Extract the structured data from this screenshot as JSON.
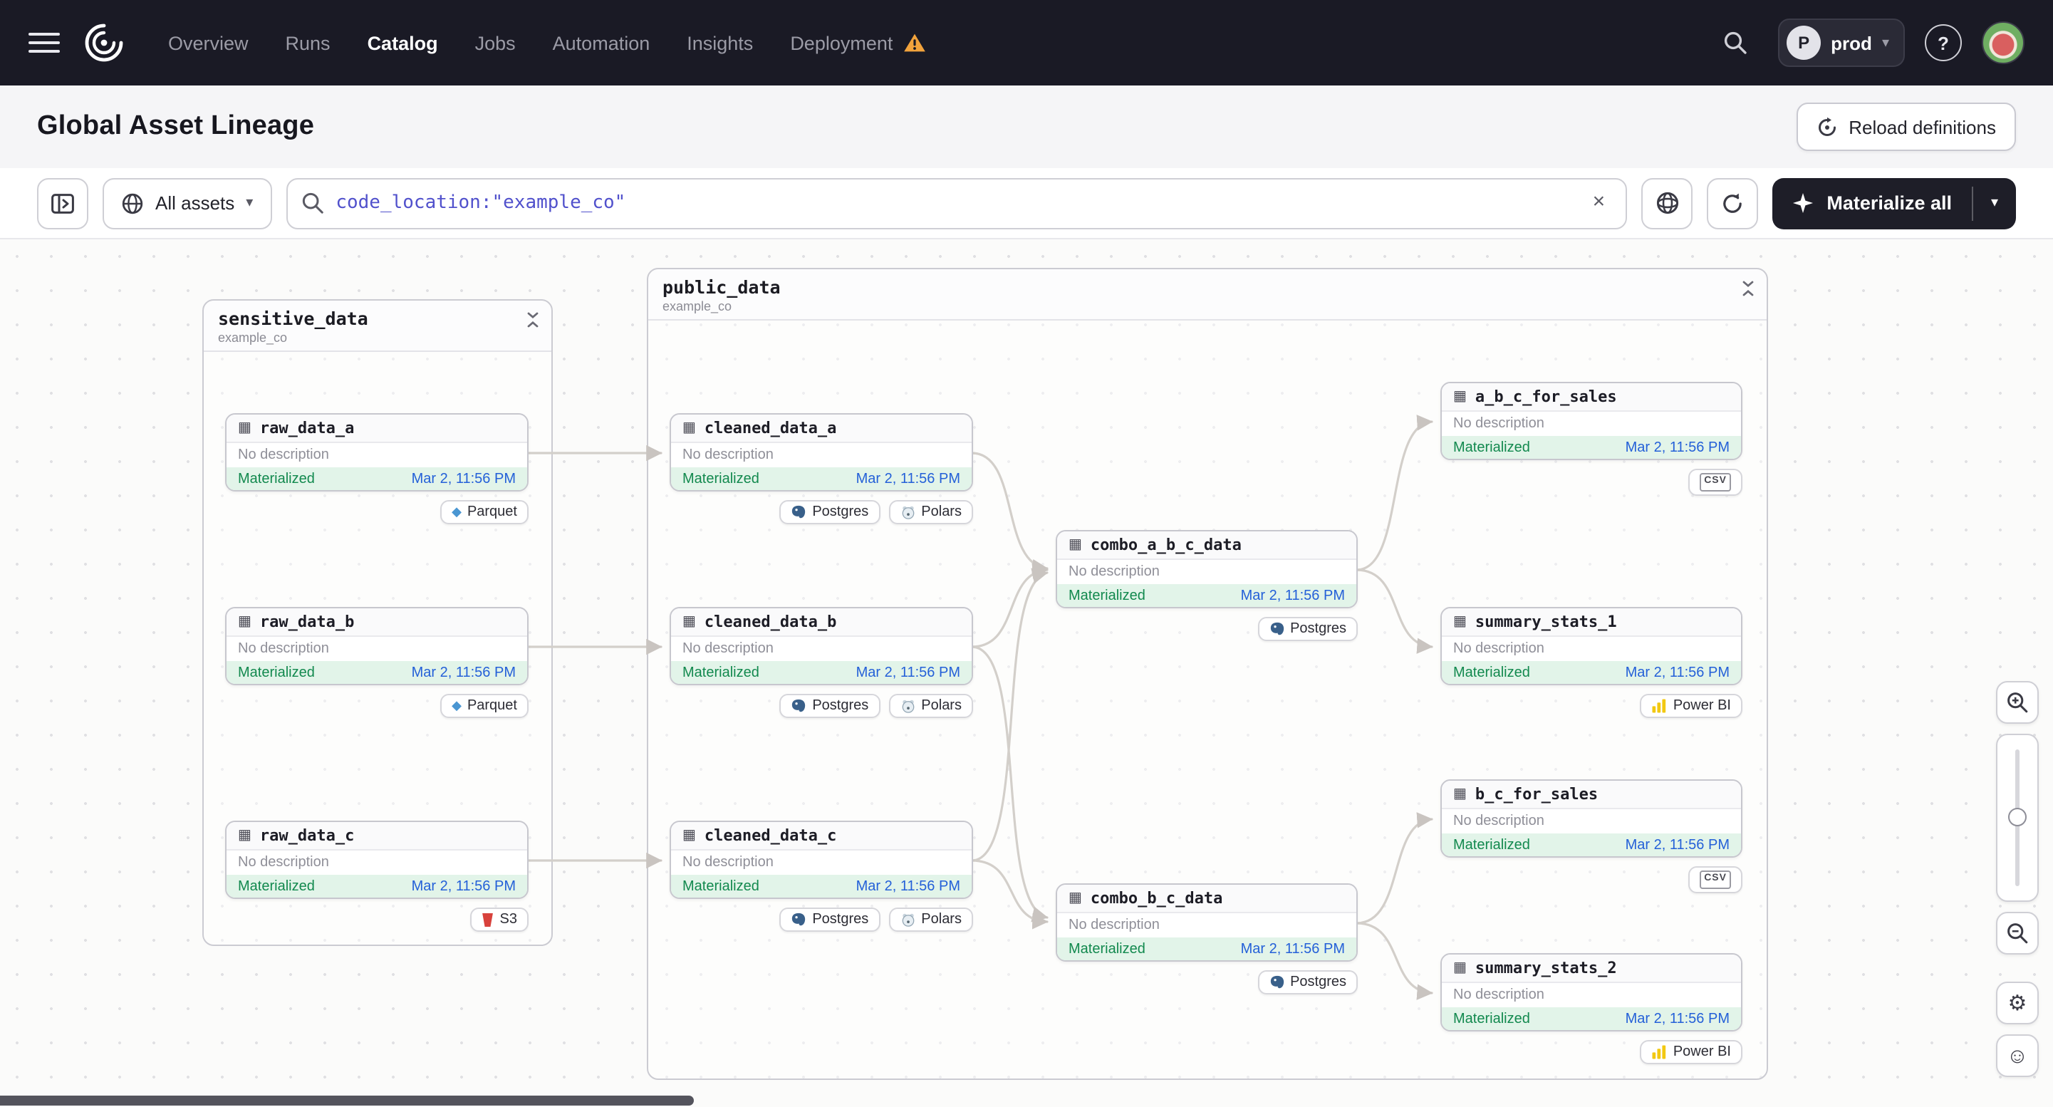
{
  "navbar": {
    "items": [
      "Overview",
      "Runs",
      "Catalog",
      "Jobs",
      "Automation",
      "Insights",
      "Deployment"
    ],
    "active_item": "Catalog",
    "env": {
      "initial": "P",
      "name": "prod"
    }
  },
  "page_header": {
    "title": "Global Asset Lineage",
    "reload_button": "Reload definitions"
  },
  "toolbar": {
    "filter_label": "All assets",
    "search": {
      "value": "code_location:\"example_co\""
    },
    "materialize_label": "Materialize all"
  },
  "graph": {
    "groups": [
      {
        "name": "sensitive_data",
        "location": "example_co"
      },
      {
        "name": "public_data",
        "location": "example_co"
      }
    ],
    "nodes": [
      {
        "name": "raw_data_a",
        "description": "No description",
        "status": "Materialized",
        "timestamp": "Mar 2, 11:56 PM",
        "tags": [
          "Parquet"
        ]
      },
      {
        "name": "raw_data_b",
        "description": "No description",
        "status": "Materialized",
        "timestamp": "Mar 2, 11:56 PM",
        "tags": [
          "Parquet"
        ]
      },
      {
        "name": "raw_data_c",
        "description": "No description",
        "status": "Materialized",
        "timestamp": "Mar 2, 11:56 PM",
        "tags": [
          "S3"
        ]
      },
      {
        "name": "cleaned_data_a",
        "description": "No description",
        "status": "Materialized",
        "timestamp": "Mar 2, 11:56 PM",
        "tags": [
          "Postgres",
          "Polars"
        ]
      },
      {
        "name": "cleaned_data_b",
        "description": "No description",
        "status": "Materialized",
        "timestamp": "Mar 2, 11:56 PM",
        "tags": [
          "Postgres",
          "Polars"
        ]
      },
      {
        "name": "cleaned_data_c",
        "description": "No description",
        "status": "Materialized",
        "timestamp": "Mar 2, 11:56 PM",
        "tags": [
          "Postgres",
          "Polars"
        ]
      },
      {
        "name": "combo_a_b_c_data",
        "description": "No description",
        "status": "Materialized",
        "timestamp": "Mar 2, 11:56 PM",
        "tags": [
          "Postgres"
        ]
      },
      {
        "name": "combo_b_c_data",
        "description": "No description",
        "status": "Materialized",
        "timestamp": "Mar 2, 11:56 PM",
        "tags": [
          "Postgres"
        ]
      },
      {
        "name": "a_b_c_for_sales",
        "description": "No description",
        "status": "Materialized",
        "timestamp": "Mar 2, 11:56 PM",
        "tags": [
          "CSV"
        ]
      },
      {
        "name": "summary_stats_1",
        "description": "No description",
        "status": "Materialized",
        "timestamp": "Mar 2, 11:56 PM",
        "tags": [
          "Power BI"
        ]
      },
      {
        "name": "b_c_for_sales",
        "description": "No description",
        "status": "Materialized",
        "timestamp": "Mar 2, 11:56 PM",
        "tags": [
          "CSV"
        ]
      },
      {
        "name": "summary_stats_2",
        "description": "No description",
        "status": "Materialized",
        "timestamp": "Mar 2, 11:56 PM",
        "tags": [
          "Power BI"
        ]
      }
    ]
  },
  "colors": {
    "nav_bg": "#1a1a25",
    "materialized_green": "#12894e",
    "timestamp_blue": "#2460d8",
    "warning_orange": "#f2a33c",
    "search_text": "#5151cc"
  }
}
